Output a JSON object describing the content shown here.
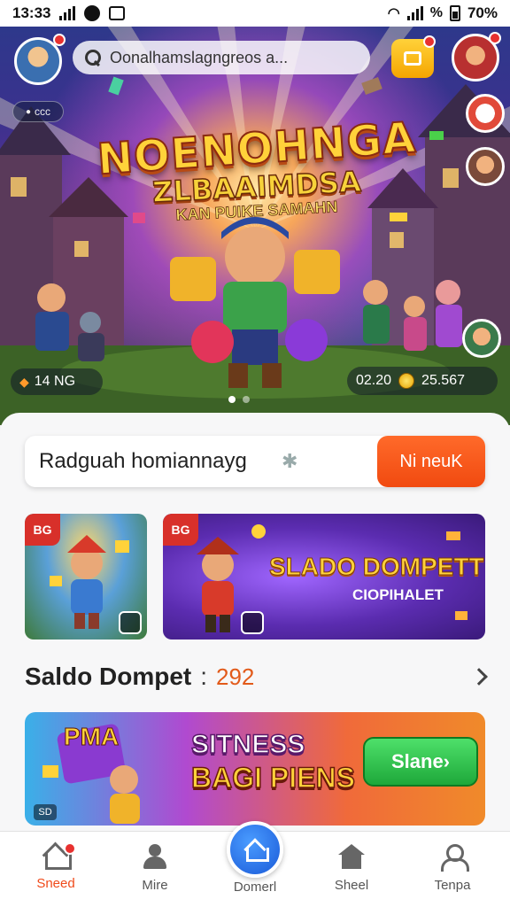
{
  "status_bar": {
    "time": "13:33",
    "battery": "70%"
  },
  "colors": {
    "accent": "#f14a10",
    "nav_active": "#1a5ad8",
    "green_btn": "#1ea83a"
  },
  "header": {
    "search_text": "Oonalhamslagngreos a...",
    "left_avatar_icon": "player-avatar-icon",
    "coin_button_icon": "coin-wallet-icon",
    "right_avatar_icon": "profile-avatar-icon",
    "pill_text": "ccc"
  },
  "hero": {
    "title_line1": "NOENOHNGA",
    "title_line2": "ZLBAAIMDSA",
    "title_line3": "KAN PUIKE SAMAHN",
    "stat_left": "14 NG",
    "stat_right_a": "02.20",
    "stat_right_b": "25.567",
    "carousel_pages": 2,
    "carousel_active": 1
  },
  "sheet": {
    "input_value": "Radguah homiannayg",
    "input_button": "Ni neuK",
    "card_a_badge": "BG",
    "card_b_badge": "BG",
    "card_b_title": "SLADO DOMPETT",
    "card_b_subtitle": "CIOPIHALET",
    "saldo_label": "Saldo Dompet",
    "saldo_colon": ":",
    "saldo_value": "292",
    "promo_title1": "SITNESS",
    "promo_title2": "BAGI PIENS",
    "promo_button": "Slane›",
    "promo_badge": "SD",
    "promo_logo": "PMA"
  },
  "nav": {
    "items": [
      {
        "label": "Sneed",
        "icon": "home-icon"
      },
      {
        "label": "Mire",
        "icon": "person-icon"
      },
      {
        "label": "Domerl",
        "icon": "home-center-icon"
      },
      {
        "label": "Sheel",
        "icon": "store-icon"
      },
      {
        "label": "Tenpa",
        "icon": "user-icon"
      }
    ]
  }
}
